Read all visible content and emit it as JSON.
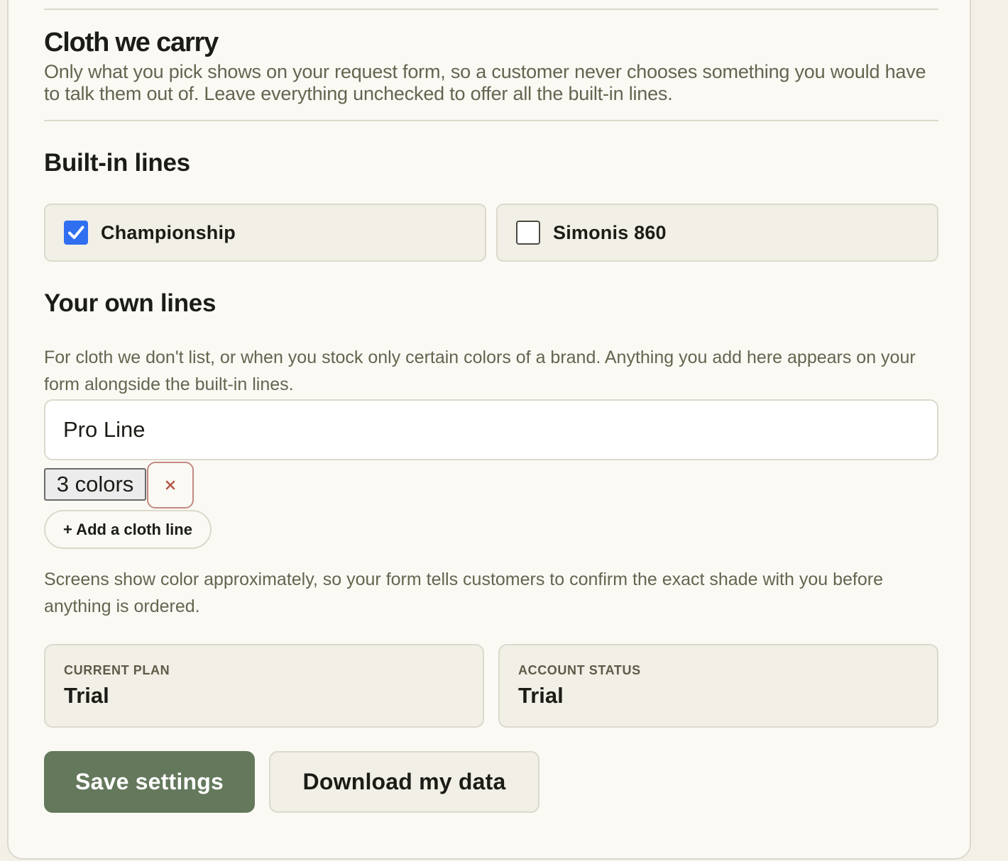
{
  "section": {
    "title": "Cloth we carry",
    "description": "Only what you pick shows on your request form, so a customer never chooses something you would have to talk them out of. Leave everything unchecked to offer all the built-in lines."
  },
  "builtin": {
    "title": "Built-in lines",
    "items": [
      {
        "label": "Championship",
        "checked": true
      },
      {
        "label": "Simonis 860",
        "checked": false
      }
    ]
  },
  "own_lines": {
    "title": "Your own lines",
    "help": "For cloth we don't list, or when you stock only certain colors of a brand. Anything you add here appears on your form alongside the built-in lines.",
    "line_name": "Pro Line",
    "colors_label": "3 colors",
    "remove_symbol": "×",
    "add_label": "+ Add a cloth line",
    "note": "Screens show color approximately, so your form tells customers to confirm the exact shade with you before anything is ordered."
  },
  "plan": {
    "label": "Current plan",
    "value": "Trial"
  },
  "status": {
    "label": "Account status",
    "value": "Trial"
  },
  "actions": {
    "save_label": "Save settings",
    "download_label": "Download my data"
  },
  "colors": {
    "accent_check": "#2f6ff0",
    "primary_button": "#64785c",
    "remove_border": "#c28a82",
    "remove_icon": "#b5594b"
  }
}
